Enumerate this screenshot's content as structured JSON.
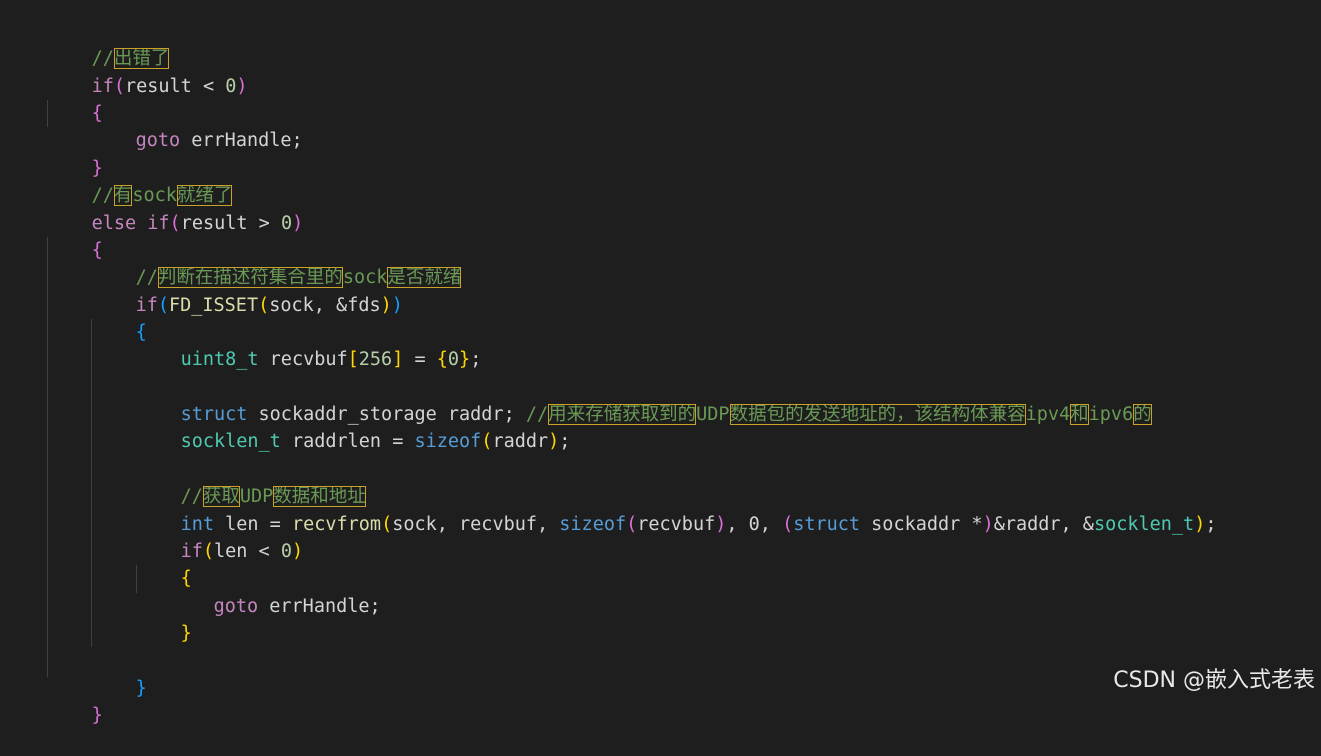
{
  "colors": {
    "background": "#1e1e1e",
    "keyword_control": "#c586c0",
    "keyword_storage": "#569cd6",
    "type": "#4ec9b0",
    "function": "#dcdcaa",
    "number": "#b5cea8",
    "comment": "#6a9955",
    "bracket_level1": "#ffd700",
    "bracket_level2": "#da70d6",
    "bracket_level3": "#179fff",
    "highlight_box": "#c9a227"
  },
  "code": {
    "comment_error": {
      "slashes": "//",
      "cjk": "出错了"
    },
    "if_result": {
      "kw": "if",
      "open": "(",
      "var": "result",
      "op": " < ",
      "num": "0",
      "close": ")"
    },
    "brace_open_1": "{",
    "goto_1": {
      "kw": "goto",
      "label": " errHandle;"
    },
    "brace_close_1": "}",
    "comment_ready": {
      "slashes": "//",
      "cjk1": "有",
      "ascii": "sock",
      "cjk2": "就绪了"
    },
    "elseif_result": {
      "kw1": "else",
      "kw2": "if",
      "open": "(",
      "var": "result",
      "op": " > ",
      "num": "0",
      "close": ")"
    },
    "brace_open_2": "{",
    "comment_judge": {
      "slashes": "//",
      "cjk1": "判断在描述符集合里的",
      "ascii": "sock",
      "cjk2": "是否就绪"
    },
    "if_fdisset": {
      "kw": "if",
      "open1": "(",
      "fn": "FD_ISSET",
      "open2": "(",
      "args": "sock, &fds",
      "close2": ")",
      "close1": ")"
    },
    "brace_open_3": "{",
    "recvbuf_decl": {
      "type": "uint8_t",
      "name": " recvbuf",
      "lb": "[",
      "size": "256",
      "rb": "]",
      "eq": " = ",
      "lc": "{",
      "zero": "0",
      "rc": "}",
      "semi": ";"
    },
    "storage_decl": {
      "kw": "struct",
      "rest": " sockaddr_storage raddr; ",
      "slashes": "//",
      "cjk1": "用来存储获取到的",
      "a1": "UDP",
      "cjk2": "数据包的发送地址的，该结构体兼容",
      "a2": "ipv4",
      "cjk3": "和",
      "a3": "ipv6",
      "cjk4": "的"
    },
    "socklen_decl": {
      "type": "socklen_t",
      "rest": " raddrlen = ",
      "fn": "sizeof",
      "open": "(",
      "arg": "raddr",
      "close": ")",
      "semi": ";"
    },
    "comment_fetch": {
      "slashes": "//",
      "cjk1": "获取",
      "ascii": "UDP",
      "cjk2": "数据和地址"
    },
    "recvfrom_line": {
      "type": "int",
      "rest1": " len = ",
      "fn1": "recvfrom",
      "open1": "(",
      "args1": "sock, recvbuf, ",
      "fn2": "sizeof",
      "open2": "(",
      "arg2": "recvbuf",
      "close2": ")",
      "args2": ", 0, ",
      "open3": "(",
      "kw": "struct",
      "cast": " sockaddr *",
      "close3": ")",
      "args3": "&raddr, &",
      "t2": "socklen_t",
      "close1": ")",
      "semi": ";"
    },
    "if_len": {
      "kw": "if",
      "open": "(",
      "var": "len",
      "op": " < ",
      "num": "0",
      "close": ")"
    },
    "brace_open_4": "{",
    "goto_2": {
      "kw": "goto",
      "label": " errHandle;"
    },
    "brace_close_4": "}",
    "brace_close_3": "}",
    "brace_close_2": "}"
  },
  "watermark": "CSDN @嵌入式老表"
}
